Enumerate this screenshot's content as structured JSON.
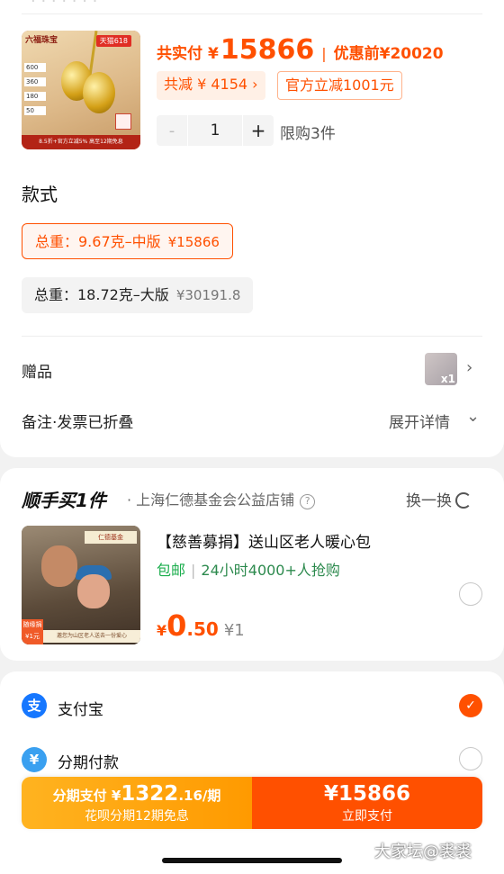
{
  "product": {
    "brand_text": "六福珠宝",
    "promo_tag": "天猫618",
    "price_tags": [
      "600",
      "360",
      "180",
      "50"
    ],
    "footer_text": "8.5折+官方立减5%  高至12期免息",
    "total_label": "共实付",
    "total_currency": "¥",
    "total_amount": "15866",
    "orig_label": "优惠前",
    "orig_amount": "¥20020",
    "discount_tag": "共减 ¥ 4154",
    "discount_chevron": "›",
    "official_tag": "官方立减1001元",
    "qty_minus": "-",
    "quantity": "1",
    "qty_plus": "+",
    "limit_text": "限购3件"
  },
  "style_section": {
    "title": "款式",
    "options": [
      {
        "label": "总重：9.67克–中版",
        "price": "¥15866",
        "selected": true
      },
      {
        "label": "总重：18.72克–大版",
        "price": "¥30191.8",
        "selected": false
      }
    ]
  },
  "gift_row": {
    "label": "赠品",
    "count": "x1",
    "chevron": "›"
  },
  "note_row": {
    "label": "备注·发票已折叠",
    "action": "展开详情",
    "chevron": "⌄"
  },
  "addon": {
    "title": "顺手买1件",
    "shop": "· 上海仁德基金会公益店铺",
    "help": "?",
    "swap": "换一换",
    "image_logo": "仁德基金",
    "image_badge": "随缘捐 ¥1元",
    "image_strip": "邀您为山区老人送去一份爱心",
    "name": "【慈善募捐】送山区老人暖心包",
    "shipping": "包邮",
    "hot": "24小时4000+人抢购",
    "price_cur": "¥",
    "price_int": "0",
    "price_dec": ".50",
    "price_orig": "¥1"
  },
  "payment": {
    "methods": [
      {
        "name": "支付宝",
        "icon": "alipay-icon",
        "icon_char": "支",
        "color": "#1677ff",
        "checked": true
      },
      {
        "name": "分期付款",
        "icon": "installment-icon",
        "icon_char": "¥",
        "color": "#3aa0f0",
        "checked": false
      }
    ]
  },
  "bottom_bar": {
    "left_prefix": "分期支付 ¥",
    "left_amount": "1322",
    "left_suffix": ".16/期",
    "left_sub": "花呗分期12期免息",
    "right_amount": "¥15866",
    "right_sub": "立即支付"
  },
  "watermark": "大家坛@裘裘",
  "colors": {
    "accent": "#ff5000",
    "green": "#1aad4c",
    "alipay": "#1677ff"
  }
}
